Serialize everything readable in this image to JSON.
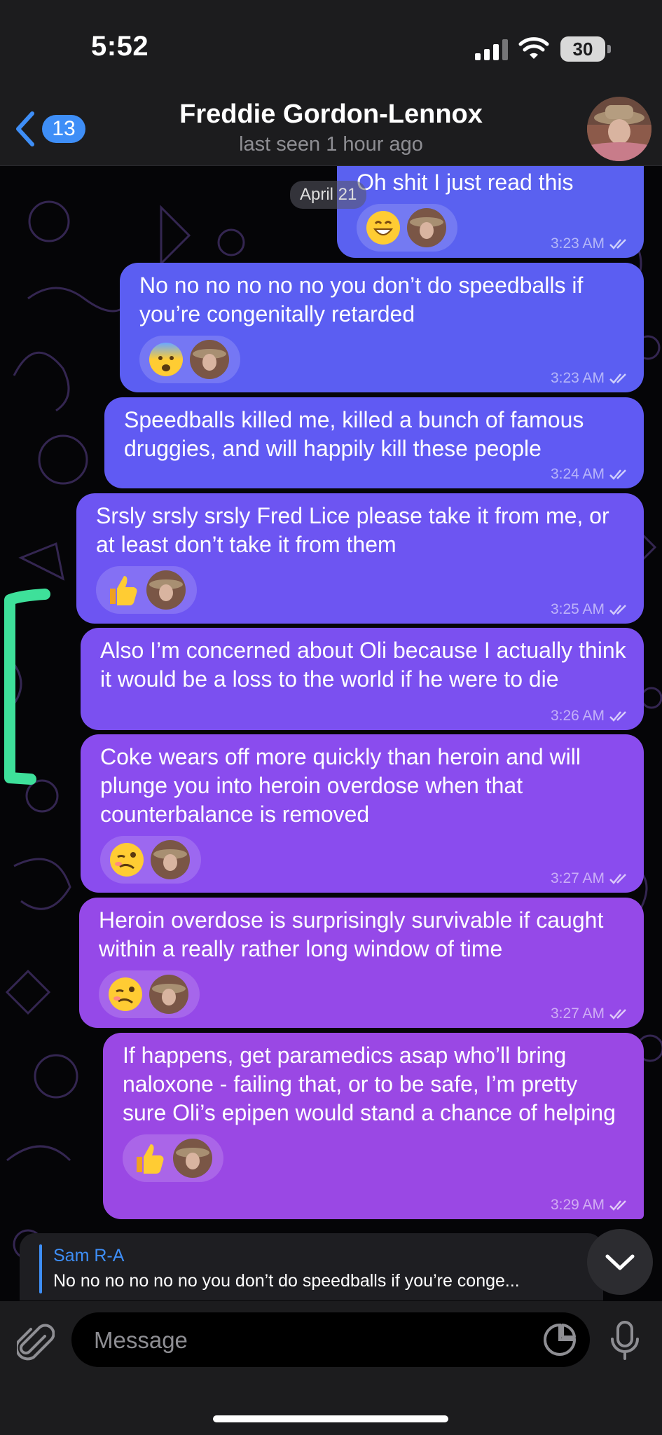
{
  "status_bar": {
    "time": "5:52",
    "battery": "30"
  },
  "header": {
    "back_count": "13",
    "title": "Freddie Gordon-Lennox",
    "subtitle": "last seen 1 hour ago"
  },
  "date_pill": "April 21",
  "messages": [
    {
      "text": "Oh shit I just read this",
      "time": "3:23 AM",
      "reaction": "grin-emoji"
    },
    {
      "text": "No no no no no no you don’t do speedballs if you’re congenitally retarded",
      "time": "3:23 AM",
      "reaction": "fearful-emoji"
    },
    {
      "text": "Speedballs killed me, killed a bunch of famous druggies, and will happily kill these people",
      "time": "3:24 AM"
    },
    {
      "text": "Srsly srsly srsly Fred Lice please take it from me, or at least don’t take it from them",
      "time": "3:25 AM",
      "reaction": "thumbs-up-emoji"
    },
    {
      "text": "Also I’m concerned about Oli because I actually think it would be a loss to the world if he were to die",
      "time": "3:26 AM"
    },
    {
      "text": "Coke wears off more quickly than heroin and will plunge you into heroin overdose when that counterbalance is removed",
      "time": "3:27 AM",
      "reaction": "woozy-emoji"
    },
    {
      "text": "Heroin overdose is surprisingly survivable if caught within a really rather long window of time",
      "time": "3:27 AM",
      "reaction": "woozy-emoji"
    },
    {
      "text": "If happens, get paramedics asap who’ll bring naloxone - failing that, or to be safe, I’m pretty sure Oli’s epipen would stand a chance of helping",
      "time": "3:29 AM",
      "reaction": "thumbs-up-emoji"
    }
  ],
  "reply": {
    "name": "Sam R-A",
    "text": "No no no no no no you don’t do speedballs if you’re conge..."
  },
  "composer": {
    "placeholder": "Message"
  }
}
